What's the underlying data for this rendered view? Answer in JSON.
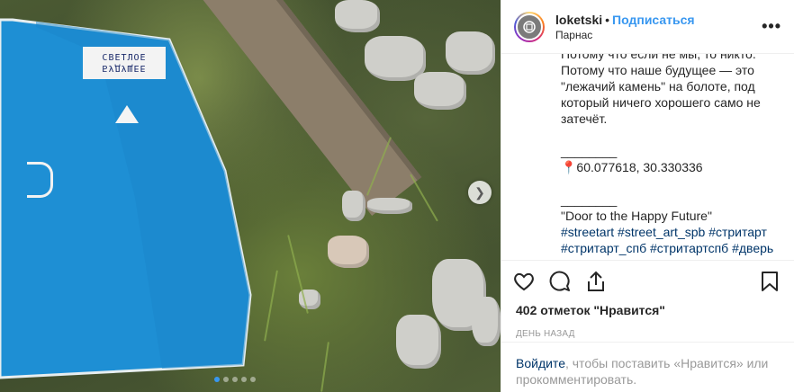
{
  "header": {
    "username": "loketski",
    "separator": "•",
    "follow_label": "Подписаться",
    "location": "Парнас",
    "more_icon": "more-horizontal-icon"
  },
  "photo": {
    "door_label_line1": "СВЕТЛОЕ",
    "door_label_line2": "БУДУЩЕЕ",
    "next_icon": "chevron-right-icon",
    "carousel_dots": 5,
    "carousel_active_index": 0
  },
  "caption": {
    "text": "Потому что если не мы, то никто.\nПотому что наше будущее — это \"лежачий камень\" на болоте, под который ничего хорошего само не затечёт.\n\n________\n📍60.077618, 30.330336\n\n________\n\"Door to the Happy Future\"",
    "hashtags": "#streetart #street_art_spb #стритарт #стритарт_спб #стритартспб #дверь #будущее #светлоебудущее #парнас #future #loketski"
  },
  "actions": {
    "like_icon": "heart-icon",
    "comment_icon": "comment-icon",
    "share_icon": "share-icon",
    "save_icon": "bookmark-icon",
    "likes_text": "402 отметок \"Нравится\"",
    "time_text": "ДЕНЬ НАЗАД"
  },
  "login": {
    "link_label": "Войдите",
    "rest_text": ", чтобы поставить «Нравится» или прокомментировать."
  },
  "colors": {
    "door_blue": "#1e8fd4",
    "link_blue": "#3897f0",
    "hashtag_blue": "#003569"
  }
}
